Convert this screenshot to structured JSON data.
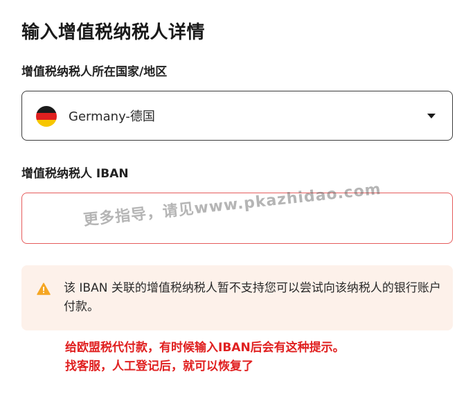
{
  "page": {
    "title": "输入增值税纳税人详情"
  },
  "country_field": {
    "label": "增值税纳税人所在国家/地区",
    "selected_value": "Germany-德国",
    "flag_icon": "germany-flag-icon"
  },
  "iban_field": {
    "label": "增值税纳税人 IBAN",
    "value": "",
    "placeholder": "",
    "border_color": "#e55b5b"
  },
  "warning": {
    "icon": "warning-triangle-icon",
    "text": "该 IBAN 关联的增值税纳税人暂不支持您可以尝试向该纳税人的银行账户付款。",
    "background": "#fdf1ea",
    "icon_color": "#f5a623"
  },
  "watermark": {
    "text": "更多指导，请见www.pkazhidao.com"
  },
  "annotation": {
    "line1": "给欧盟税代付款，有时候输入IBAN后会有这种提示。",
    "line2": "找客服，人工登记后，就可以恢复了",
    "color": "#e02020"
  }
}
